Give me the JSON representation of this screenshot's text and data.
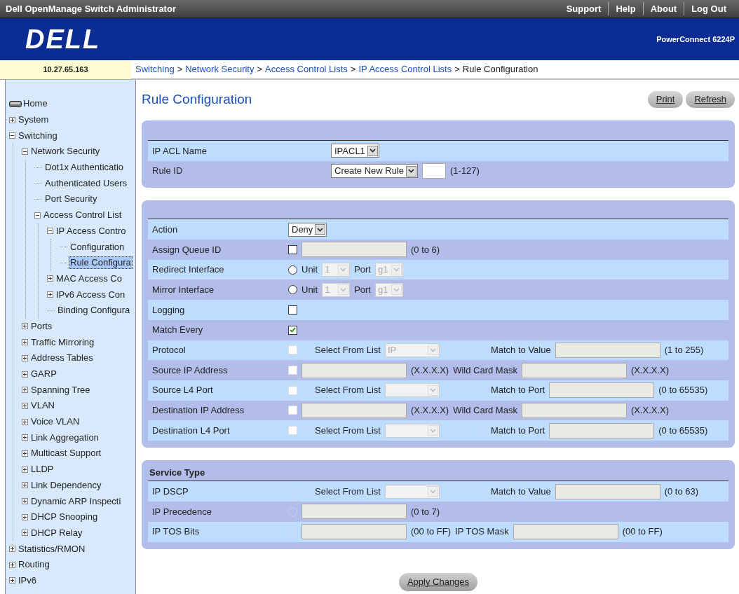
{
  "top_bar": {
    "title": "Dell OpenManage Switch Administrator",
    "links": [
      "Support",
      "Help",
      "About",
      "Log Out"
    ]
  },
  "banner": {
    "logo": "DELL",
    "model": "PowerConnect 6224P"
  },
  "ip_address": "10.27.65.163",
  "breadcrumb": {
    "separator": ">",
    "items": [
      {
        "text": "Switching",
        "kind": "link"
      },
      {
        "text": "Network Security",
        "kind": "link"
      },
      {
        "text": "Access Control Lists",
        "kind": "link"
      },
      {
        "text": "IP Access Control Lists",
        "kind": "link"
      },
      {
        "text": "Rule Configuration",
        "kind": "current"
      }
    ]
  },
  "sidebar": {
    "items": [
      {
        "label": "Home",
        "kind": "home",
        "selected": false
      },
      {
        "label": "System",
        "expanded": false,
        "selected": false
      },
      {
        "label": "Switching",
        "expanded": true,
        "selected": false,
        "children": [
          {
            "label": "Network Security",
            "expanded": true,
            "selected": false,
            "children": [
              {
                "label": "Dot1x Authenticatio",
                "selected": false
              },
              {
                "label": "Authenticated Users",
                "selected": false
              },
              {
                "label": "Port Security",
                "selected": false
              },
              {
                "label": "Access Control List",
                "expanded": true,
                "selected": false,
                "children": [
                  {
                    "label": "IP Access Contro",
                    "expanded": true,
                    "selected": false,
                    "children": [
                      {
                        "label": "Configuration",
                        "selected": false
                      },
                      {
                        "label": "Rule Configura",
                        "selected": true
                      }
                    ]
                  },
                  {
                    "label": "MAC Access Co",
                    "expanded": false,
                    "selected": false
                  },
                  {
                    "label": "IPv6 Access Con",
                    "expanded": false,
                    "selected": false
                  },
                  {
                    "label": "Binding Configura",
                    "selected": false
                  }
                ]
              }
            ]
          },
          {
            "label": "Ports",
            "expanded": false,
            "selected": false
          },
          {
            "label": "Traffic Mirroring",
            "expanded": false,
            "selected": false
          },
          {
            "label": "Address Tables",
            "expanded": false,
            "selected": false
          },
          {
            "label": "GARP",
            "expanded": false,
            "selected": false
          },
          {
            "label": "Spanning Tree",
            "expanded": false,
            "selected": false
          },
          {
            "label": "VLAN",
            "expanded": false,
            "selected": false
          },
          {
            "label": "Voice VLAN",
            "expanded": false,
            "selected": false
          },
          {
            "label": "Link Aggregation",
            "expanded": false,
            "selected": false
          },
          {
            "label": "Multicast Support",
            "expanded": false,
            "selected": false
          },
          {
            "label": "LLDP",
            "expanded": false,
            "selected": false
          },
          {
            "label": "Link Dependency",
            "expanded": false,
            "selected": false
          },
          {
            "label": "Dynamic ARP Inspecti",
            "expanded": false,
            "selected": false
          },
          {
            "label": "DHCP Snooping",
            "expanded": false,
            "selected": false
          },
          {
            "label": "DHCP Relay",
            "expanded": false,
            "selected": false
          }
        ]
      },
      {
        "label": "Statistics/RMON",
        "expanded": false,
        "selected": false
      },
      {
        "label": "Routing",
        "expanded": false,
        "selected": false
      },
      {
        "label": "IPv6",
        "expanded": false,
        "selected": false
      }
    ]
  },
  "page": {
    "title": "Rule Configuration",
    "buttons": [
      "Print",
      "Refresh"
    ]
  },
  "sections": [
    {
      "rows": [
        {
          "label": "IP ACL Name",
          "widgets": [
            {
              "kind": "dropdown",
              "value": "IPACL1"
            }
          ]
        },
        {
          "label": "Rule ID",
          "widgets": [
            {
              "kind": "dropdown",
              "value": "Create New Rule"
            },
            {
              "kind": "small-field",
              "disabled": false
            },
            {
              "kind": "note",
              "text": "(1-127)"
            }
          ]
        }
      ]
    },
    {
      "rows": [
        {
          "label": "Action",
          "widgets": [
            {
              "kind": "dropdown",
              "value": "Deny"
            }
          ]
        },
        {
          "label": "Assign Queue ID",
          "widgets": [
            {
              "kind": "checkbox",
              "checked": false,
              "disabled": false
            },
            {
              "kind": "field",
              "disabled": true
            },
            {
              "kind": "note",
              "text": "(0 to 6)"
            }
          ]
        },
        {
          "label": "Redirect Interface",
          "widgets": [
            {
              "kind": "radio",
              "selected": false,
              "disabled": false
            },
            {
              "kind": "note",
              "text": "Unit"
            },
            {
              "kind": "mini-picker",
              "value": "1"
            },
            {
              "kind": "note",
              "text": "Port"
            },
            {
              "kind": "mini-picker",
              "value": "g1"
            }
          ]
        },
        {
          "label": "Mirror Interface",
          "widgets": [
            {
              "kind": "radio",
              "selected": false,
              "disabled": false
            },
            {
              "kind": "note",
              "text": "Unit"
            },
            {
              "kind": "mini-picker",
              "value": "1"
            },
            {
              "kind": "note",
              "text": "Port"
            },
            {
              "kind": "mini-picker",
              "value": "g1"
            }
          ]
        },
        {
          "label": "Logging",
          "widgets": [
            {
              "kind": "checkbox",
              "checked": false,
              "disabled": false
            }
          ]
        },
        {
          "label": "Match Every",
          "widgets": [
            {
              "kind": "checkbox",
              "checked": true,
              "disabled": false
            }
          ]
        },
        {
          "label": "Protocol",
          "widgets": [
            {
              "kind": "checkbox",
              "checked": false,
              "disabled": true
            },
            {
              "kind": "radio",
              "selected": false,
              "disabled": true
            },
            {
              "kind": "note",
              "text": "Select From List"
            },
            {
              "kind": "picker",
              "value": "IP"
            },
            {
              "kind": "radio",
              "selected": false,
              "disabled": true
            },
            {
              "kind": "note",
              "text": "Match to Value"
            },
            {
              "kind": "field",
              "disabled": true
            },
            {
              "kind": "note",
              "text": "(1 to 255)"
            }
          ]
        },
        {
          "label": "Source IP Address",
          "widgets": [
            {
              "kind": "checkbox",
              "checked": false,
              "disabled": true
            },
            {
              "kind": "field",
              "disabled": true
            },
            {
              "kind": "note",
              "text": "(X.X.X.X)"
            },
            {
              "kind": "note",
              "text": "Wild Card Mask"
            },
            {
              "kind": "field",
              "disabled": true
            },
            {
              "kind": "note",
              "text": "(X.X.X.X)"
            }
          ]
        },
        {
          "label": "Source L4 Port",
          "widgets": [
            {
              "kind": "checkbox",
              "checked": false,
              "disabled": true
            },
            {
              "kind": "radio",
              "selected": false,
              "disabled": true
            },
            {
              "kind": "note",
              "text": "Select From List"
            },
            {
              "kind": "picker"
            },
            {
              "kind": "radio",
              "selected": false,
              "disabled": true
            },
            {
              "kind": "note",
              "text": "Match to Port"
            },
            {
              "kind": "field",
              "disabled": true
            },
            {
              "kind": "note",
              "text": "(0 to 65535)"
            }
          ]
        },
        {
          "label": "Destination IP Address",
          "widgets": [
            {
              "kind": "checkbox",
              "checked": false,
              "disabled": true
            },
            {
              "kind": "field",
              "disabled": true
            },
            {
              "kind": "note",
              "text": "(X.X.X.X)"
            },
            {
              "kind": "note",
              "text": "Wild Card Mask"
            },
            {
              "kind": "field",
              "disabled": true
            },
            {
              "kind": "note",
              "text": "(X.X.X.X)"
            }
          ]
        },
        {
          "label": "Destination L4 Port",
          "widgets": [
            {
              "kind": "checkbox",
              "checked": false,
              "disabled": true
            },
            {
              "kind": "radio",
              "selected": false,
              "disabled": true
            },
            {
              "kind": "note",
              "text": "Select From List"
            },
            {
              "kind": "picker"
            },
            {
              "kind": "radio",
              "selected": false,
              "disabled": true
            },
            {
              "kind": "note",
              "text": "Match to Port"
            },
            {
              "kind": "field",
              "disabled": true
            },
            {
              "kind": "note",
              "text": "(0 to 65535)"
            }
          ]
        }
      ]
    },
    {
      "heading": "Service Type",
      "rows": [
        {
          "label": "IP DSCP",
          "widgets": [
            {
              "kind": "radio",
              "selected": false,
              "disabled": true
            },
            {
              "kind": "radio",
              "selected": false,
              "disabled": true
            },
            {
              "kind": "note",
              "text": "Select From List"
            },
            {
              "kind": "picker"
            },
            {
              "kind": "radio",
              "selected": false,
              "disabled": true
            },
            {
              "kind": "note",
              "text": "Match to Value"
            },
            {
              "kind": "field",
              "disabled": true
            },
            {
              "kind": "note",
              "text": "(0 to 63)"
            }
          ]
        },
        {
          "label": "IP Precedence",
          "widgets": [
            {
              "kind": "radio",
              "selected": false,
              "disabled": true
            },
            {
              "kind": "field",
              "disabled": true
            },
            {
              "kind": "note",
              "text": "(0 to 7)"
            }
          ]
        },
        {
          "label": "IP TOS Bits",
          "widgets": [
            {
              "kind": "radio",
              "selected": false,
              "disabled": true
            },
            {
              "kind": "field",
              "disabled": true
            },
            {
              "kind": "note",
              "text": "(00 to FF)"
            },
            {
              "kind": "note",
              "text": "IP TOS Mask"
            },
            {
              "kind": "field",
              "disabled": true
            },
            {
              "kind": "note",
              "text": "(00 to FF)"
            }
          ]
        }
      ]
    }
  ],
  "apply_button": "Apply Changes"
}
